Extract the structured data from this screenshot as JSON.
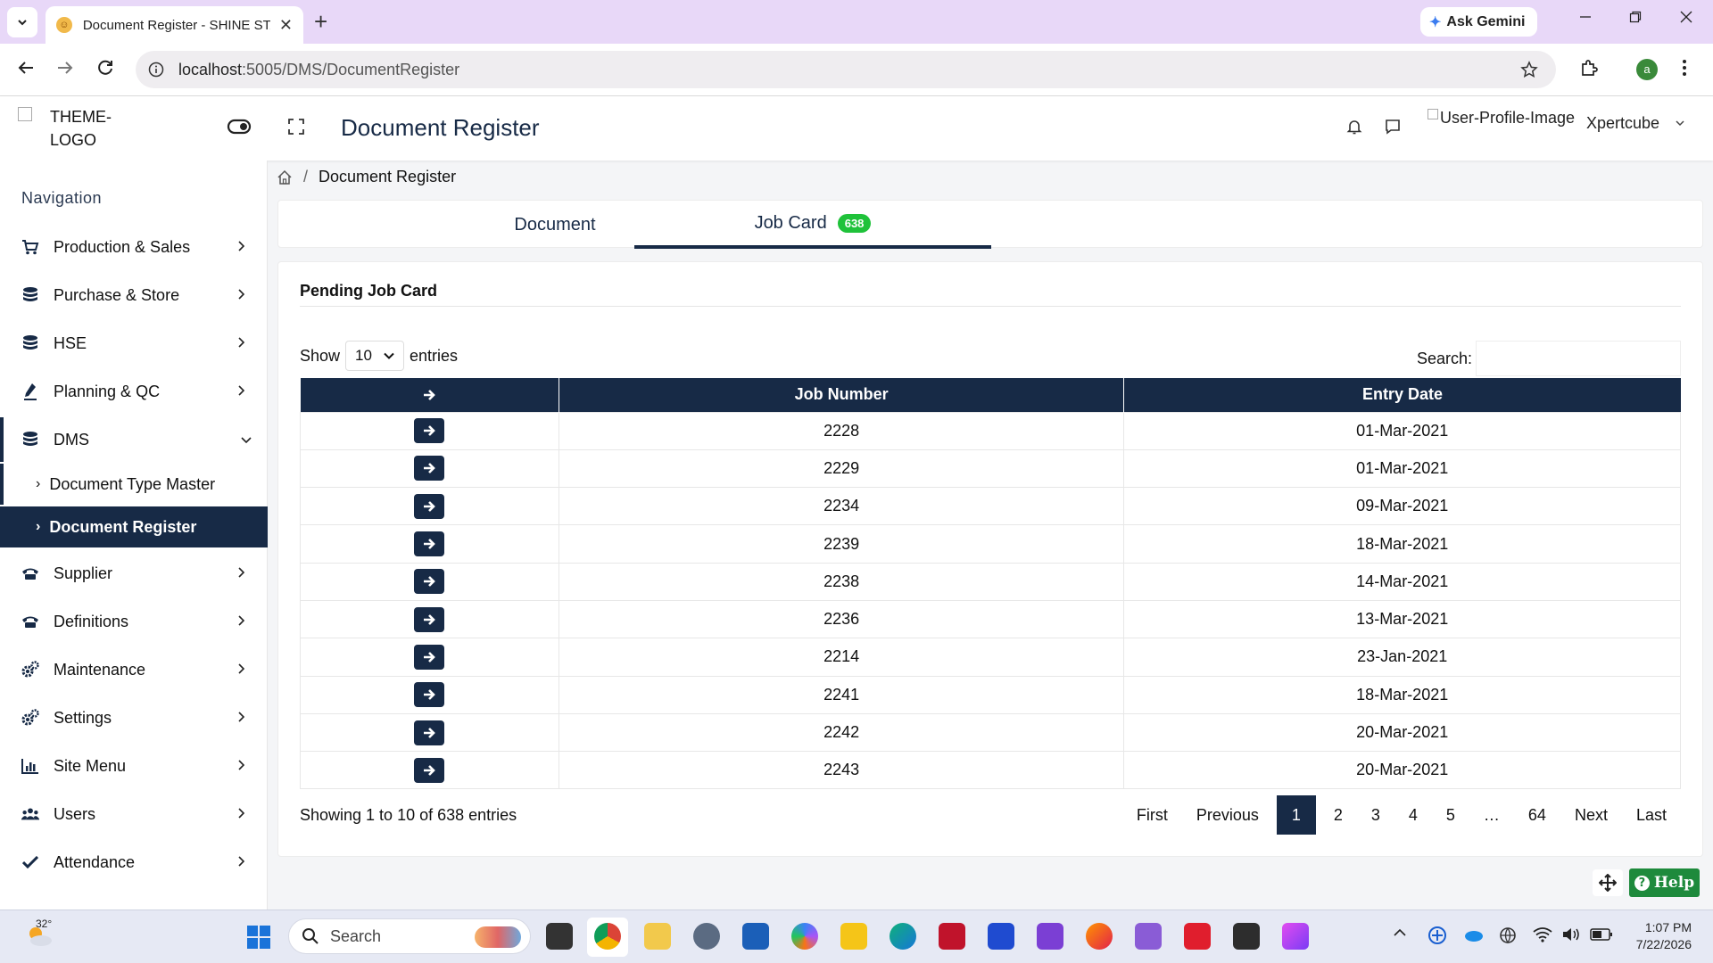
{
  "browser": {
    "tab_title": "Document Register - SHINE STA",
    "tab_close": "✕",
    "new_tab": "+",
    "gemini_label": "Ask Gemini",
    "url_host": "localhost",
    "url_path": ":5005/DMS/DocumentRegister",
    "profile_initial": "a"
  },
  "header": {
    "logo_alt": "THEME-LOGO",
    "page_title": "Document Register",
    "user_image_alt": "User-Profile-Image",
    "user_name": "Xpertcube"
  },
  "sidebar": {
    "caption": "Navigation",
    "items": [
      {
        "label": "Production & Sales",
        "icon": "cart-icon"
      },
      {
        "label": "Purchase & Store",
        "icon": "database-icon"
      },
      {
        "label": "HSE",
        "icon": "database-icon"
      },
      {
        "label": "Planning & QC",
        "icon": "pen-icon"
      },
      {
        "label": "DMS",
        "icon": "database-icon"
      },
      {
        "label": "Supplier",
        "icon": "phone-icon"
      },
      {
        "label": "Definitions",
        "icon": "phone-icon"
      },
      {
        "label": "Maintenance",
        "icon": "gears-icon"
      },
      {
        "label": "Settings",
        "icon": "gears-icon"
      },
      {
        "label": "Site Menu",
        "icon": "bar-chart-icon"
      },
      {
        "label": "Users",
        "icon": "users-icon"
      },
      {
        "label": "Attendance",
        "icon": "check-icon"
      }
    ],
    "dms_children": [
      {
        "label": "Document Type Master"
      },
      {
        "label": "Document Register"
      }
    ]
  },
  "breadcrumb": {
    "separator": "/",
    "current": "Document Register"
  },
  "tabs": [
    {
      "label": "Document"
    },
    {
      "label": "Job Card",
      "badge": "638"
    }
  ],
  "panel": {
    "title": "Pending Job Card",
    "show_label": "Show",
    "page_size": "10",
    "entries_label": "entries",
    "search_label": "Search:",
    "columns": [
      "Job Number",
      "Entry Date"
    ],
    "rows": [
      {
        "job": "2228",
        "date": "01-Mar-2021"
      },
      {
        "job": "2229",
        "date": "01-Mar-2021"
      },
      {
        "job": "2234",
        "date": "09-Mar-2021"
      },
      {
        "job": "2239",
        "date": "18-Mar-2021"
      },
      {
        "job": "2238",
        "date": "14-Mar-2021"
      },
      {
        "job": "2236",
        "date": "13-Mar-2021"
      },
      {
        "job": "2214",
        "date": "23-Jan-2021"
      },
      {
        "job": "2241",
        "date": "18-Mar-2021"
      },
      {
        "job": "2242",
        "date": "20-Mar-2021"
      },
      {
        "job": "2243",
        "date": "20-Mar-2021"
      }
    ],
    "info": "Showing 1 to 10 of 638 entries",
    "pager": {
      "first": "First",
      "previous": "Previous",
      "pages": [
        "1",
        "2",
        "3",
        "4",
        "5"
      ],
      "ellipsis": "…",
      "last_page": "64",
      "next": "Next",
      "last": "Last"
    }
  },
  "help_label": "Help",
  "taskbar": {
    "temperature": "32°",
    "search_label": "Search",
    "time": "1:07 PM",
    "date": "7/22/2026"
  }
}
